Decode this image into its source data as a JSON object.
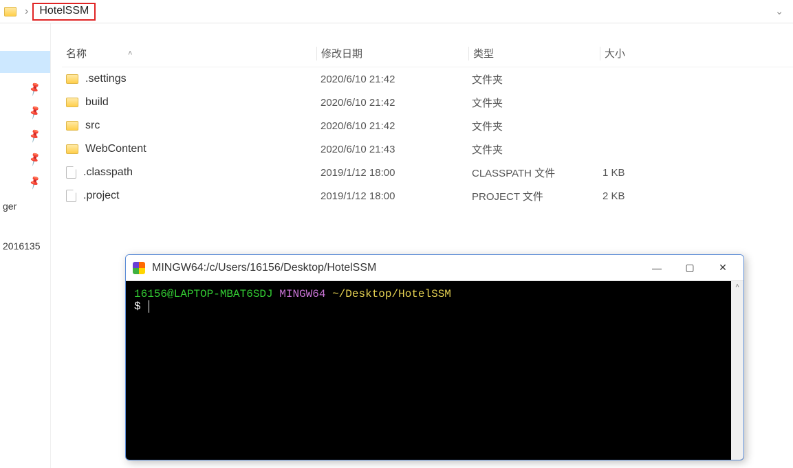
{
  "breadcrumb": {
    "current": "HotelSSM"
  },
  "columns": {
    "name": "名称",
    "date": "修改日期",
    "type": "类型",
    "size": "大小"
  },
  "files": [
    {
      "icon": "folder",
      "name": ".settings",
      "date": "2020/6/10 21:42",
      "type": "文件夹",
      "size": ""
    },
    {
      "icon": "folder",
      "name": "build",
      "date": "2020/6/10 21:42",
      "type": "文件夹",
      "size": ""
    },
    {
      "icon": "folder",
      "name": "src",
      "date": "2020/6/10 21:42",
      "type": "文件夹",
      "size": ""
    },
    {
      "icon": "folder",
      "name": "WebContent",
      "date": "2020/6/10 21:43",
      "type": "文件夹",
      "size": ""
    },
    {
      "icon": "file",
      "name": ".classpath",
      "date": "2019/1/12 18:00",
      "type": "CLASSPATH 文件",
      "size": "1 KB"
    },
    {
      "icon": "file",
      "name": ".project",
      "date": "2019/1/12 18:00",
      "type": "PROJECT 文件",
      "size": "2 KB"
    }
  ],
  "sidebar": {
    "label1": "ger",
    "label2": "2016135"
  },
  "terminal": {
    "title": "MINGW64:/c/Users/16156/Desktop/HotelSSM",
    "prompt_user": "16156@LAPTOP-MBAT6SDJ",
    "prompt_host": "MINGW64",
    "prompt_path": "~/Desktop/HotelSSM",
    "prompt_symbol": "$"
  }
}
